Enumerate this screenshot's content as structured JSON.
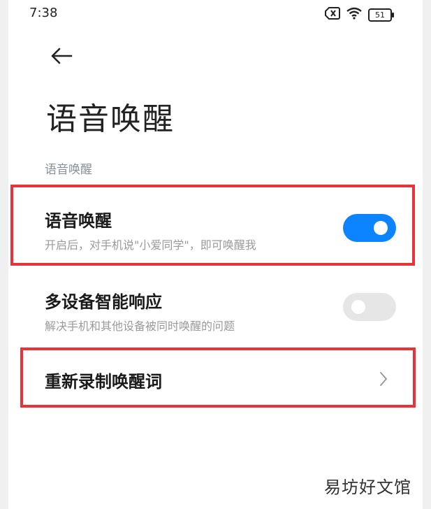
{
  "status_bar": {
    "time": "7:38",
    "battery": "51"
  },
  "header": {
    "title": "语音唤醒"
  },
  "section": {
    "title": "语音唤醒"
  },
  "settings": [
    {
      "title": "语音唤醒",
      "description": "开启后，对手机说\"小爱同学\"，即可唤醒我",
      "toggle": "on"
    },
    {
      "title": "多设备智能响应",
      "description": "解决手机和其他设备被同时唤醒的问题",
      "toggle": "off"
    },
    {
      "title": "重新录制唤醒词"
    }
  ],
  "colors": {
    "accent": "#0d84ff",
    "highlight": "#e8333a",
    "toggle_off": "#e6e6e6"
  },
  "icons": [
    "sim-off-icon",
    "wifi-icon",
    "battery-icon",
    "back-arrow-icon",
    "chevron-right-icon"
  ],
  "watermark": "易坊好文馆"
}
